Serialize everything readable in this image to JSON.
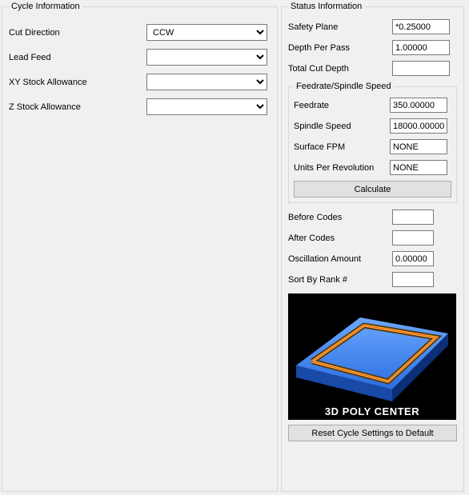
{
  "cycle": {
    "legend": "Cycle Information",
    "cut_direction": {
      "label": "Cut Direction",
      "value": "CCW"
    },
    "lead_feed": {
      "label": "Lead Feed",
      "value": ""
    },
    "xy_stock_allowance": {
      "label": "XY Stock Allowance",
      "value": ""
    },
    "z_stock_allowance": {
      "label": "Z Stock Allowance",
      "value": ""
    }
  },
  "status": {
    "legend": "Status Information",
    "safety_plane": {
      "label": "Safety Plane",
      "value": "*0.25000"
    },
    "depth_per_pass": {
      "label": "Depth Per Pass",
      "value": "1.00000"
    },
    "total_cut_depth": {
      "label": "Total Cut Depth",
      "value": ""
    },
    "feedrate_group": {
      "legend": "Feedrate/Spindle Speed",
      "feedrate": {
        "label": "Feedrate",
        "value": "350.00000"
      },
      "spindle_speed": {
        "label": "Spindle Speed",
        "value": "18000.00000"
      },
      "surface_fpm": {
        "label": "Surface FPM",
        "value": "NONE"
      },
      "units_per_rev": {
        "label": "Units Per Revolution",
        "value": "NONE"
      },
      "calculate_label": "Calculate"
    },
    "before_codes": {
      "label": "Before Codes",
      "value": ""
    },
    "after_codes": {
      "label": "After Codes",
      "value": ""
    },
    "oscillation_amount": {
      "label": "Oscillation Amount",
      "value": "0.00000"
    },
    "sort_by_rank": {
      "label": "Sort By Rank #",
      "value": ""
    },
    "preview_caption": "3D POLY CENTER",
    "reset_label": "Reset Cycle Settings to Default"
  }
}
